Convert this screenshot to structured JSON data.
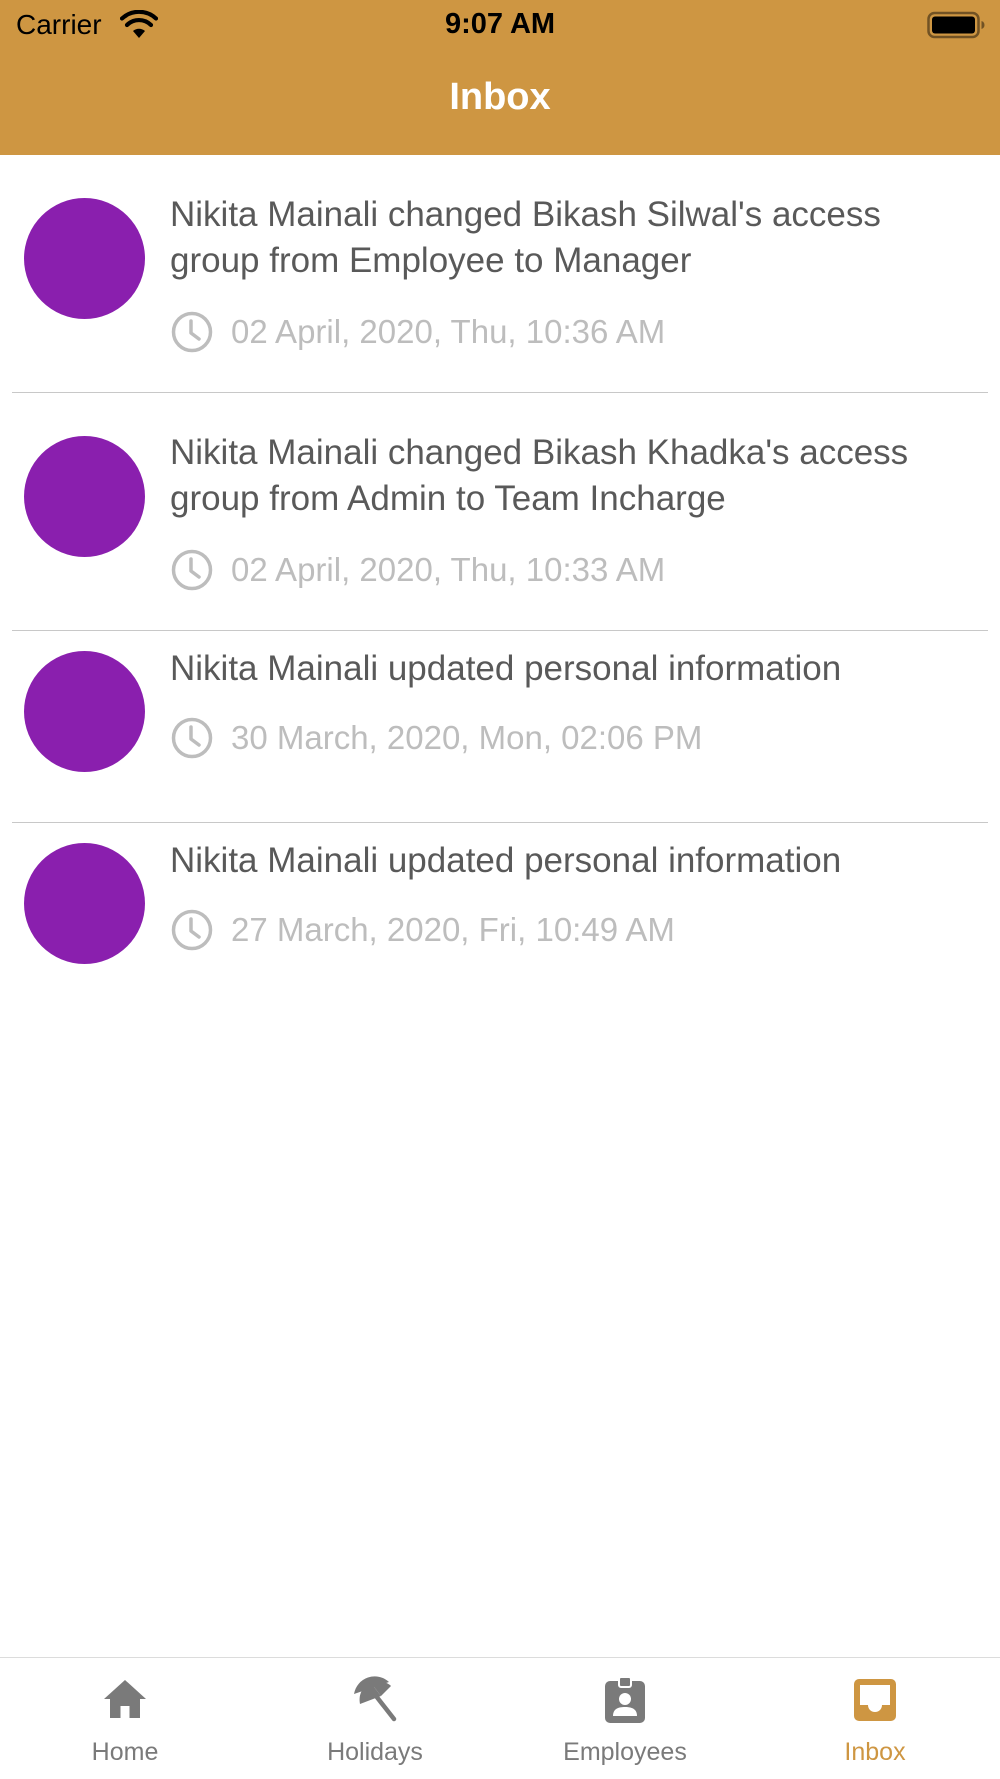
{
  "status_bar": {
    "carrier": "Carrier",
    "time": "9:07 AM"
  },
  "header": {
    "title": "Inbox",
    "color": "#CE9642"
  },
  "notifications": [
    {
      "message": "Nikita Mainali changed Bikash  Silwal's access group from Employee to Manager",
      "timestamp": "02 April, 2020, Thu, 10:36 AM"
    },
    {
      "message": "Nikita Mainali changed Bikash  Khadka's access group from Admin to Team Incharge",
      "timestamp": "02 April, 2020, Thu, 10:33 AM"
    },
    {
      "message": "Nikita Mainali updated personal information",
      "timestamp": "30 March, 2020, Mon, 02:06 PM"
    },
    {
      "message": "Nikita Mainali updated personal information",
      "timestamp": "27 March, 2020, Fri, 10:49 AM"
    }
  ],
  "avatar_color": "#8A1FAE",
  "tabbar": {
    "active_color": "#CE9642",
    "inactive_color": "#7a7a7a",
    "tabs": [
      {
        "label": "Home",
        "icon": "home-icon"
      },
      {
        "label": "Holidays",
        "icon": "beach-umbrella-icon"
      },
      {
        "label": "Employees",
        "icon": "id-badge-icon"
      },
      {
        "label": "Inbox",
        "icon": "inbox-tray-icon",
        "active": true
      }
    ]
  }
}
